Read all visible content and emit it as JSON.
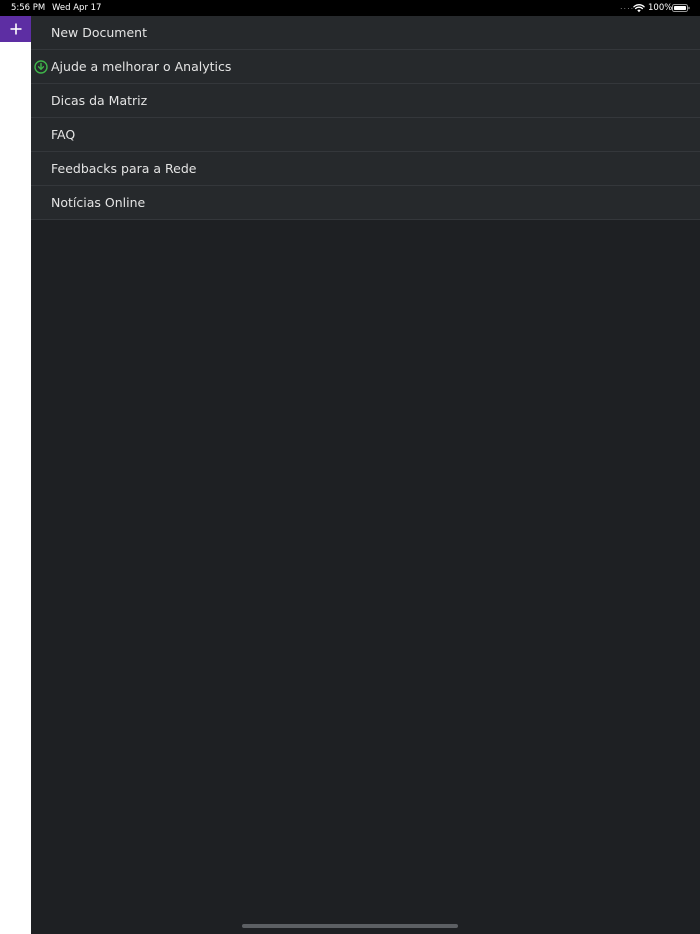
{
  "status_bar": {
    "time": "5:56 PM",
    "date": "Wed Apr 17",
    "signal_dots": "....",
    "wifi_icon": "wifi-icon",
    "battery_percent": "100%",
    "battery_icon": "battery-full-icon"
  },
  "new_tab_button": {
    "icon": "plus-icon",
    "color": "#5d2ea3"
  },
  "menu": {
    "items": [
      {
        "label": "New Document"
      },
      {
        "label": "Ajude a melhorar o Analytics",
        "icon": "download-circle-icon",
        "icon_color": "#3fb54a"
      },
      {
        "label": "Dicas da Matriz"
      },
      {
        "label": "FAQ"
      },
      {
        "label": "Feedbacks para a Rede"
      },
      {
        "label": "Notícias Online"
      }
    ]
  }
}
